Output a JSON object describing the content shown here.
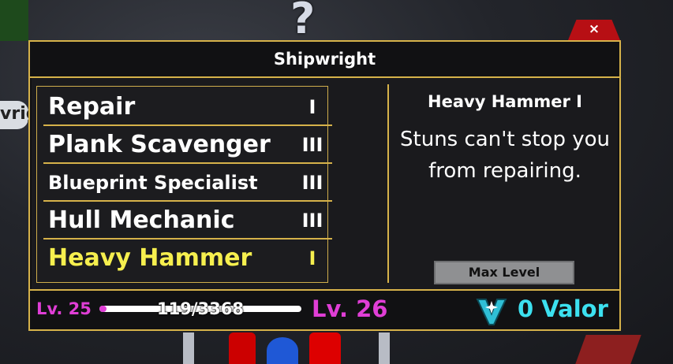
{
  "background": {
    "question_mark": "?",
    "sign_text": "vrig"
  },
  "window": {
    "title": "Shipwright",
    "close_label": "×"
  },
  "skills": [
    {
      "name": "Repair",
      "level": "I",
      "selected": false
    },
    {
      "name": "Plank Scavenger",
      "level": "III",
      "selected": false
    },
    {
      "name": "Blueprint Specialist",
      "level": "III",
      "selected": false
    },
    {
      "name": "Hull Mechanic",
      "level": "III",
      "selected": false
    },
    {
      "name": "Heavy Hammer",
      "level": "I",
      "selected": true
    }
  ],
  "detail": {
    "title": "Heavy Hammer I",
    "description": "Stuns can't stop you from repairing.",
    "button_label": "Max Level"
  },
  "progress": {
    "current_level": "Lv. 25",
    "xp_text": "119/3368",
    "xp_fraction": 0.035,
    "next_level": "Lv. 26"
  },
  "currency": {
    "valor_text": "0 Valor",
    "icon": "valor-v-icon"
  },
  "colors": {
    "border_gold": "#d6b24a",
    "selected_yellow": "#f6ef4e",
    "level_magenta": "#e03ed6",
    "valor_cyan": "#3ce0ef",
    "close_red": "#b70f14"
  }
}
